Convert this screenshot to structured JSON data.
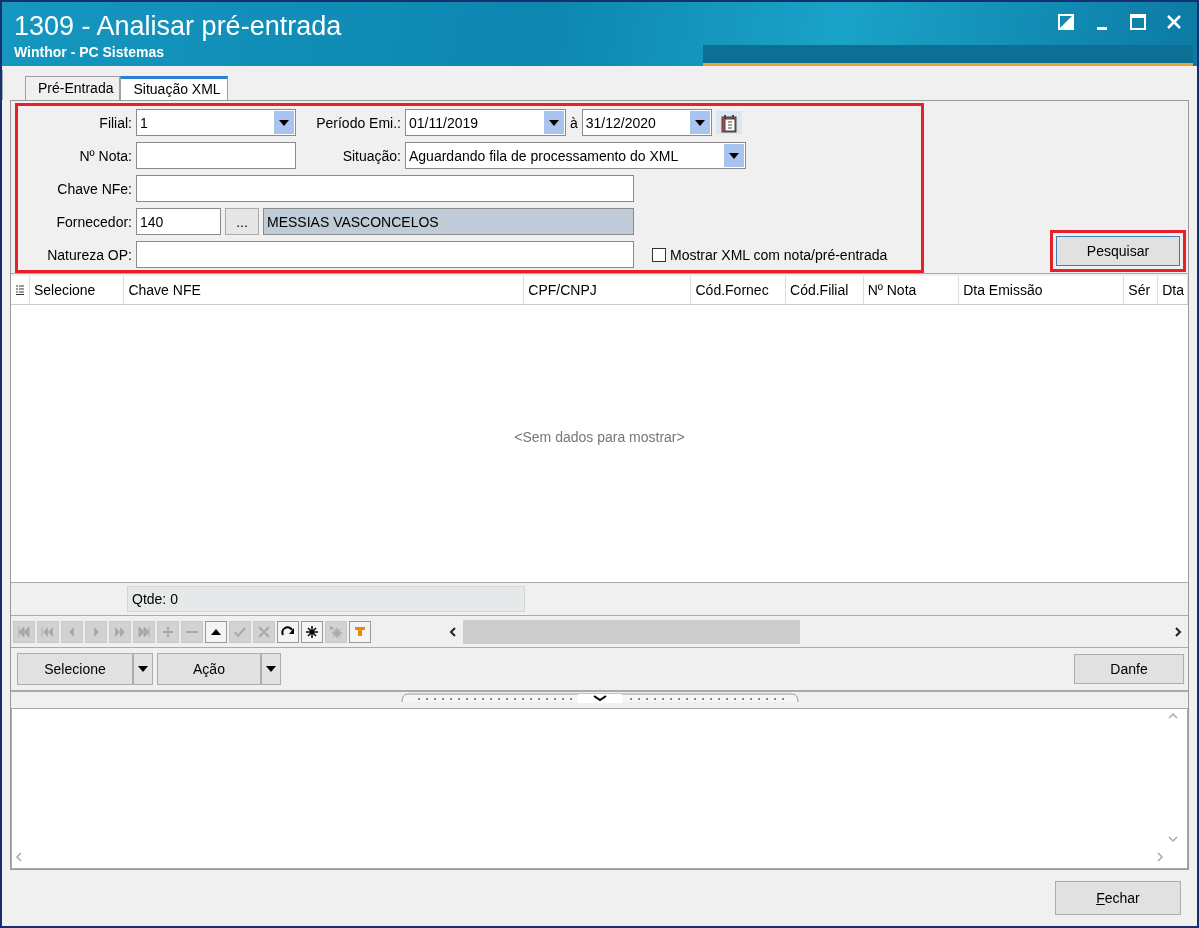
{
  "window": {
    "title": "1309 - Analisar pré-entrada",
    "subtitle": "Winthor - PC Sistemas"
  },
  "tabs": [
    {
      "label": "Pré-Entrada",
      "selected": false
    },
    {
      "label": "Situação XML",
      "selected": true
    }
  ],
  "filters": {
    "highlighted": true,
    "filial": {
      "label": "Filial:",
      "value": "1"
    },
    "periodo": {
      "label": "Período Emi.:",
      "from": "01/11/2019",
      "separator": "à",
      "to": "31/12/2020"
    },
    "nota": {
      "label": "Nº Nota:"
    },
    "situacao": {
      "label": "Situação:",
      "value": "Aguardando fila de processamento do XML"
    },
    "chave": {
      "label": "Chave NFe:"
    },
    "fornecedor": {
      "label": "Fornecedor:",
      "code": "140",
      "lookup": "...",
      "name": "MESSIAS VASCONCELOS"
    },
    "natureza": {
      "label": "Natureza OP:"
    },
    "show_xml": {
      "label": "Mostrar XML com nota/pré-entrada",
      "checked": false
    }
  },
  "search_button": {
    "label": "Pesquisar",
    "highlighted": true
  },
  "grid": {
    "columns": [
      "Selecione",
      "Chave NFE",
      "CPF/CNPJ",
      "Cód.Fornec",
      "Cód.Filial",
      "Nº Nota",
      "Dta Emissão",
      "Sér",
      "Dta"
    ],
    "empty_text": "<Sem dados para mostrar>",
    "footer": "Qtde: 0"
  },
  "navigator": [
    {
      "kind": "first",
      "disabled": true
    },
    {
      "kind": "prior-page",
      "disabled": true
    },
    {
      "kind": "prior",
      "disabled": true
    },
    {
      "kind": "next",
      "disabled": true
    },
    {
      "kind": "next-page",
      "disabled": true
    },
    {
      "kind": "last",
      "disabled": true
    },
    {
      "kind": "insert",
      "disabled": true
    },
    {
      "kind": "delete",
      "disabled": true
    },
    {
      "kind": "edit",
      "disabled": false
    },
    {
      "kind": "post",
      "disabled": true
    },
    {
      "kind": "cancel",
      "disabled": true
    },
    {
      "kind": "refresh",
      "disabled": false
    },
    {
      "kind": "bookmark",
      "disabled": false
    },
    {
      "kind": "goto-bookmark",
      "disabled": true
    },
    {
      "kind": "filter",
      "disabled": false
    }
  ],
  "action_buttons": [
    {
      "label": "Selecione",
      "dropdown": true
    },
    {
      "label": "Ação",
      "dropdown": true
    }
  ],
  "danfe_button": {
    "label": "Danfe"
  },
  "close_button": {
    "label": "Fechar"
  }
}
